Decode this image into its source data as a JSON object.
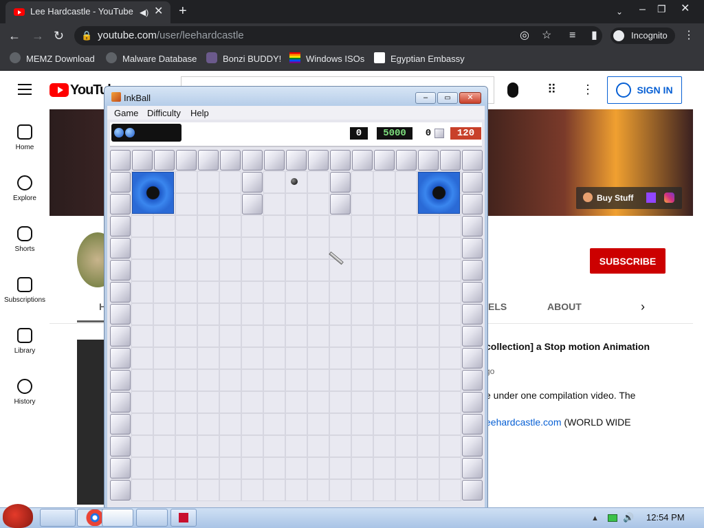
{
  "browser": {
    "tab_title": "Lee Hardcastle - YouTube",
    "new_tab": "+",
    "url_host": "youtube.com",
    "url_path": "/user/leehardcastle",
    "profile_label": "Incognito",
    "bookmarks": [
      {
        "label": "MEMZ Download",
        "icon": "globe-icon"
      },
      {
        "label": "Malware Database",
        "icon": "globe-icon"
      },
      {
        "label": "Bonzi BUDDY!",
        "icon": "bonzi-icon"
      },
      {
        "label": "Windows ISOs",
        "icon": "rainbow-flag-icon"
      },
      {
        "label": "Egyptian Embassy",
        "icon": "wix-icon"
      }
    ]
  },
  "youtube": {
    "logo_text": "YouTub",
    "signin_label": "SIGN IN",
    "sidebar": [
      {
        "label": "Home",
        "icon": "home-icon"
      },
      {
        "label": "Explore",
        "icon": "compass-icon"
      },
      {
        "label": "Shorts",
        "icon": "shorts-icon"
      },
      {
        "label": "Subscriptions",
        "icon": "subscriptions-icon"
      },
      {
        "label": "Library",
        "icon": "library-icon"
      },
      {
        "label": "History",
        "icon": "history-icon"
      }
    ],
    "buy_stuff": "Buy Stuff",
    "subscribe_label": "SUBSCRIBE",
    "tabs": {
      "home_partial": "H",
      "channels_partial": "ELS",
      "about": "ABOUT"
    },
    "video": {
      "title_partial": "collection] a Stop motion Animation",
      "meta_partial": "go",
      "desc_line1": "e under one compilation video. The",
      "desc_link": "eehardcastle.com",
      "desc_line2": " (WORLD WIDE"
    }
  },
  "inkball": {
    "window_title": "InkBall",
    "menu": [
      "Game",
      "Difficulty",
      "Help"
    ],
    "score": "0",
    "bonus": "5000",
    "balls_count": "0",
    "timer": "120",
    "colors": {
      "hole": "#2a6ad6",
      "timer_bg": "#c8402a",
      "bonus_fg": "#7ee07e"
    }
  },
  "taskbar": {
    "time": "12:54 PM"
  }
}
